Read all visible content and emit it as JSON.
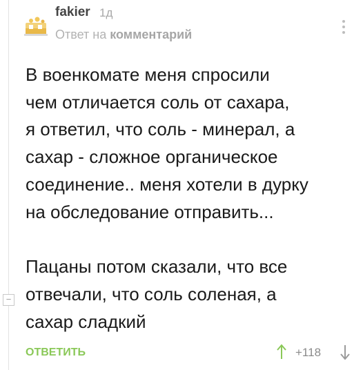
{
  "comment": {
    "username": "fakier",
    "time": "1д",
    "reply_prefix": "Ответ на",
    "reply_target": "комментарий",
    "body_lines_1": [
      "В военкомате меня спросили",
      "чем отличается соль от сахара,",
      "я ответил, что соль - минерал, а",
      "сахар - сложное органическое",
      "соединение.. меня хотели в дурку",
      "на обследование отправить..."
    ],
    "body_lines_2": [
      "Пацаны потом сказали, что все",
      "отвечали, что соль соленая, а",
      "сахар сладкий"
    ]
  },
  "actions": {
    "reply_label": "ОТВЕТИТЬ",
    "rating": "+118"
  },
  "thread": {
    "collapse_symbol": "−"
  },
  "icons": {
    "avatar": "avatar-icon",
    "more": "more-vertical-icon",
    "upvote": "arrow-up-icon",
    "downvote": "arrow-down-icon"
  },
  "colors": {
    "accent_green": "#8ac858",
    "muted_text": "#a8a8a8",
    "body_text": "#1a1a1a"
  }
}
